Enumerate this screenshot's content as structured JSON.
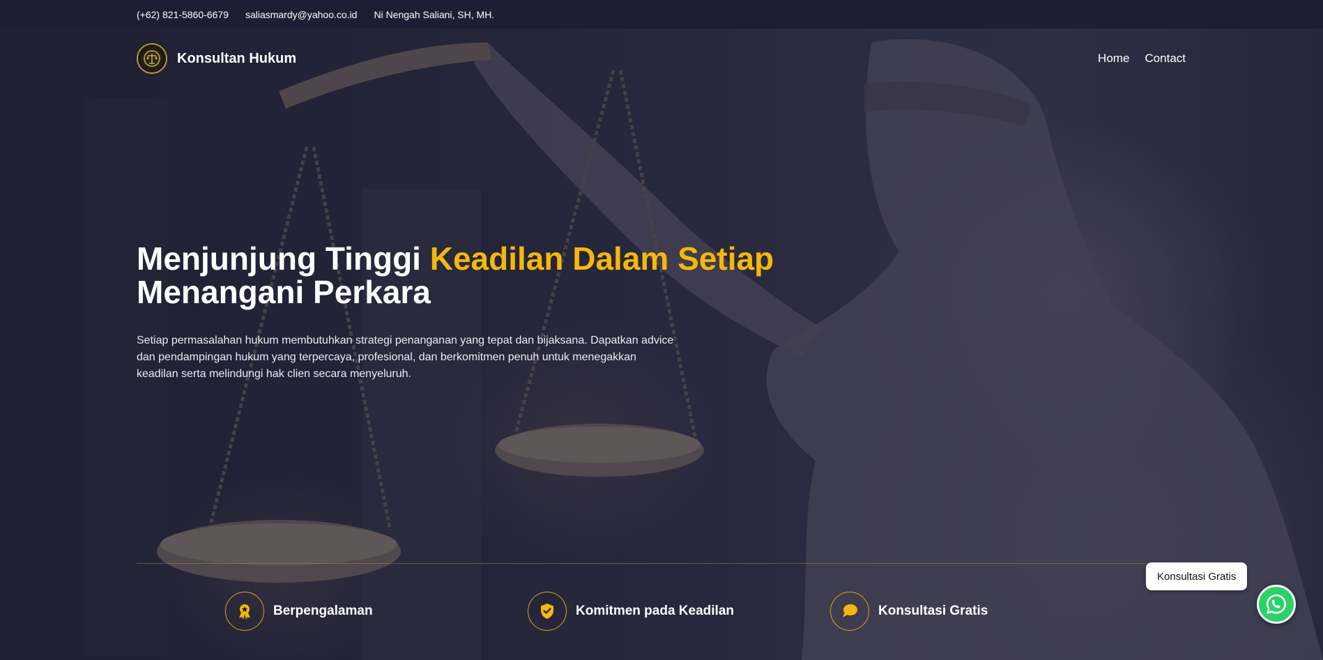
{
  "topbar": {
    "phone": "(+62) 821-5860-6679",
    "email": "saliasmardy@yahoo.co.id",
    "name": "Ni Nengah Saliani, SH, MH."
  },
  "nav": {
    "brand": "Konsultan Hukum",
    "links": [
      "Home",
      "Contact"
    ]
  },
  "hero": {
    "title_part1": "Menjunjung Tinggi",
    "title_accent": "Keadilan Dalam Setiap",
    "title_part2": "Menangani Perkara",
    "description": "Setiap permasalahan hukum membutuhkan strategi penanganan yang tepat dan bijaksana. Dapatkan advice dan pendampingan hukum yang terpercaya, profesional, dan berkomitmen penuh untuk menegakkan keadilan serta melindungi hak clien secara menyeluruh."
  },
  "features": [
    {
      "label": "Berpengalaman",
      "icon": "award-badge-icon"
    },
    {
      "label": "Komitmen pada Keadilan",
      "icon": "shield-check-icon"
    },
    {
      "label": "Konsultasi Gratis",
      "icon": "chat-bubble-icon"
    }
  ],
  "whatsapp": {
    "label": "Konsultasi Gratis",
    "icon": "whatsapp-icon"
  },
  "colors": {
    "accent": "#f5b70a",
    "topbar": "#1d1e33",
    "whatsapp": "#29d366"
  }
}
